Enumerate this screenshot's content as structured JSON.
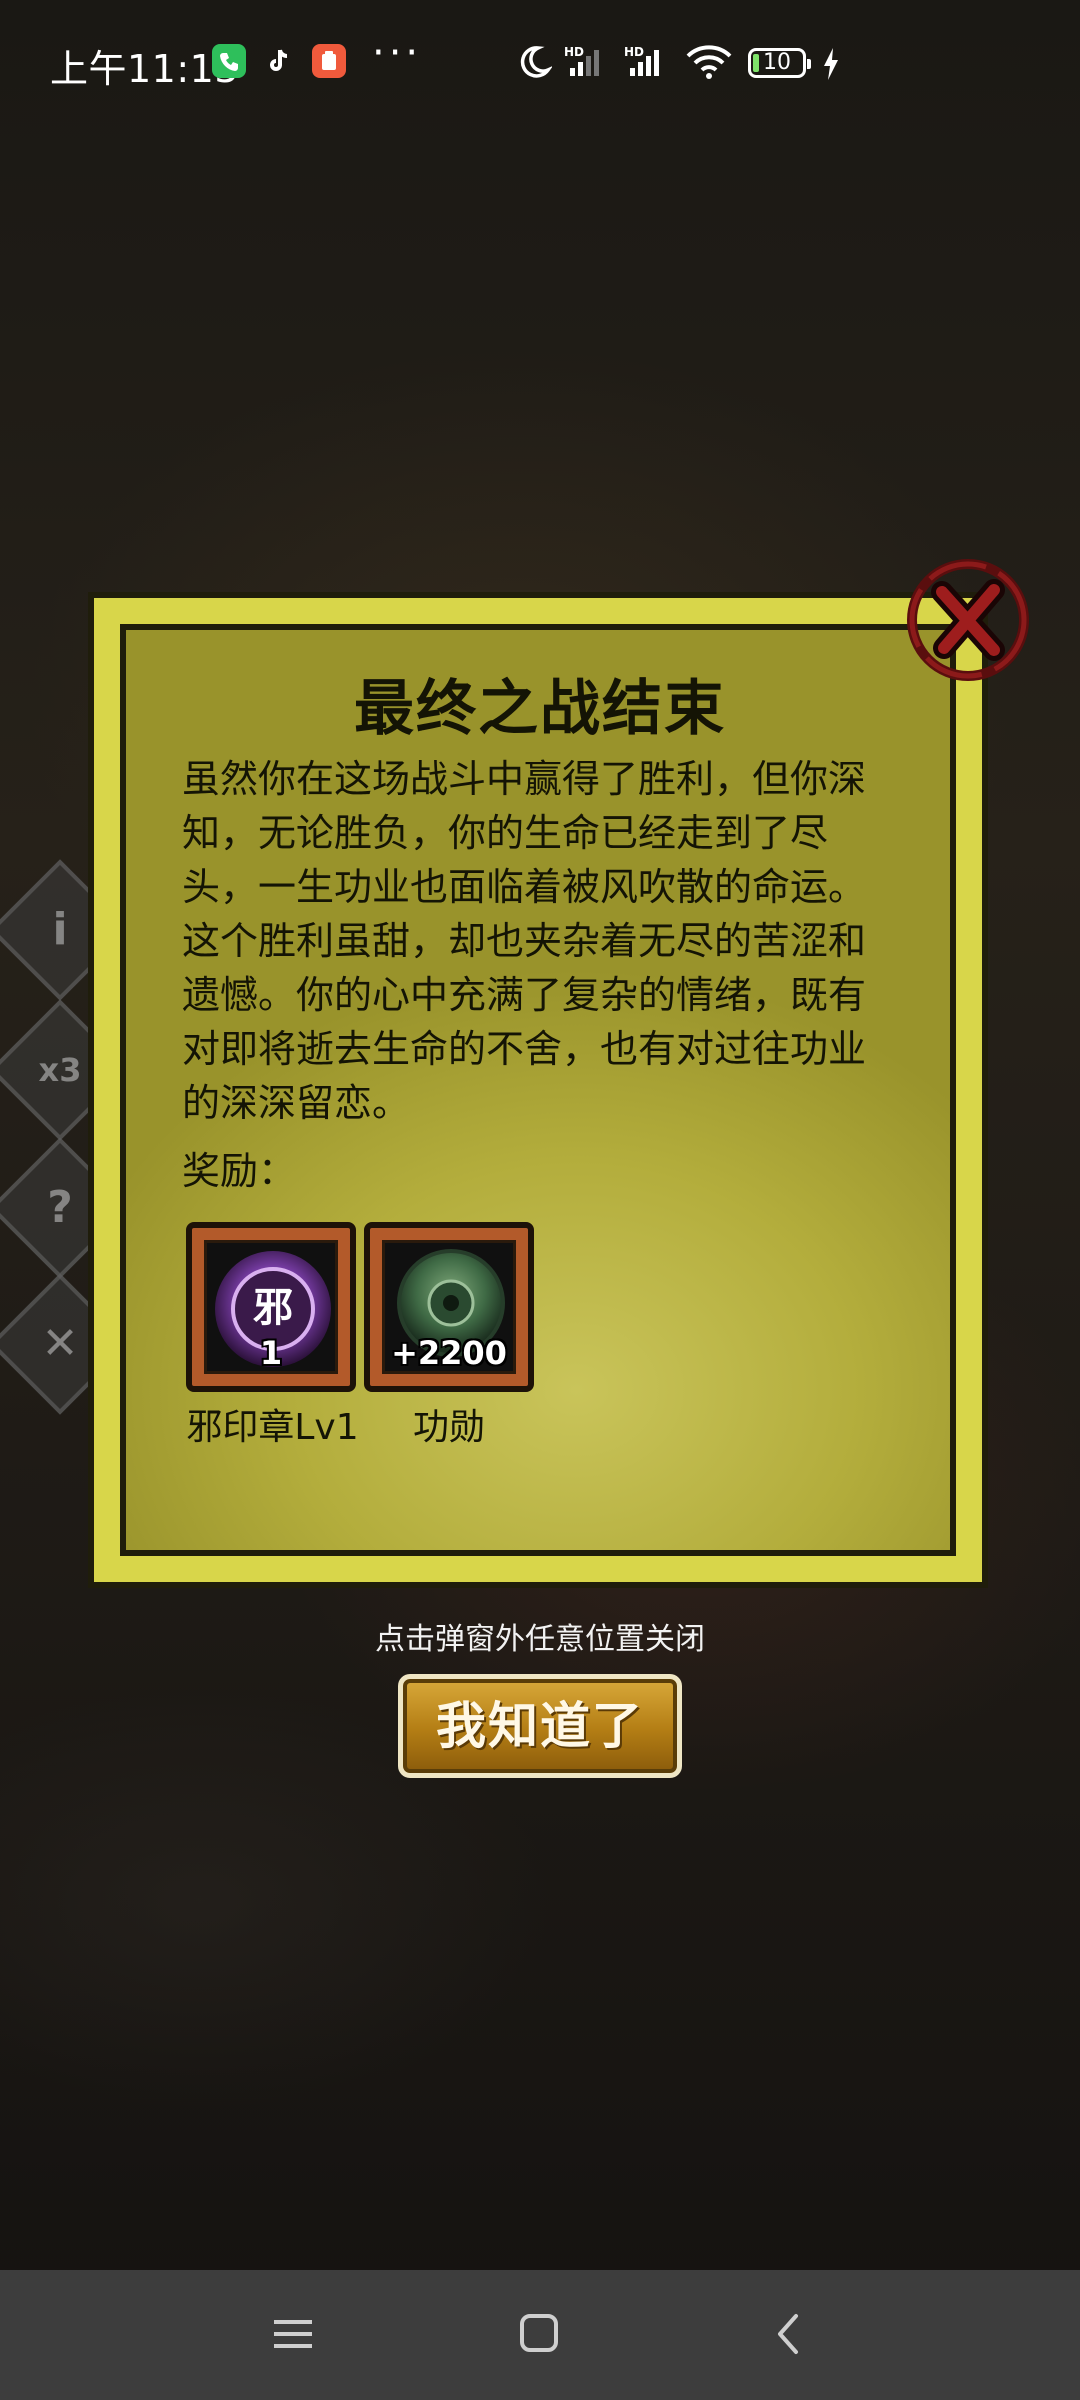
{
  "status_bar": {
    "time": "上午11:13",
    "battery": "10"
  },
  "modal": {
    "title": "最终之战结束",
    "body": "虽然你在这场战斗中赢得了胜利，但你深知，无论胜负，你的生命已经走到了尽头，一生功业也面临着被风吹散的命运。这个胜利虽甜，却也夹杂着无尽的苦涩和遗憾。你的心中充满了复杂的情绪，既有对即将逝去生命的不舍，也有对过往功业的深深留恋。",
    "reward_label": "奖励：",
    "rewards": [
      {
        "icon_text": "邪",
        "amount": "1",
        "name": "邪印章Lv1",
        "icon": "purple-seal-icon"
      },
      {
        "icon_text": "",
        "amount": "+2200",
        "name": "功勋",
        "icon": "jade-medal-icon"
      }
    ]
  },
  "hint": "点击弹窗外任意位置关闭",
  "ok_button": "我知道了",
  "colors": {
    "panel": "#d8d64a",
    "panel_inner": "#b3ad3c",
    "button_gold": "#b37d14",
    "reward_frame": "#b35a2a"
  }
}
